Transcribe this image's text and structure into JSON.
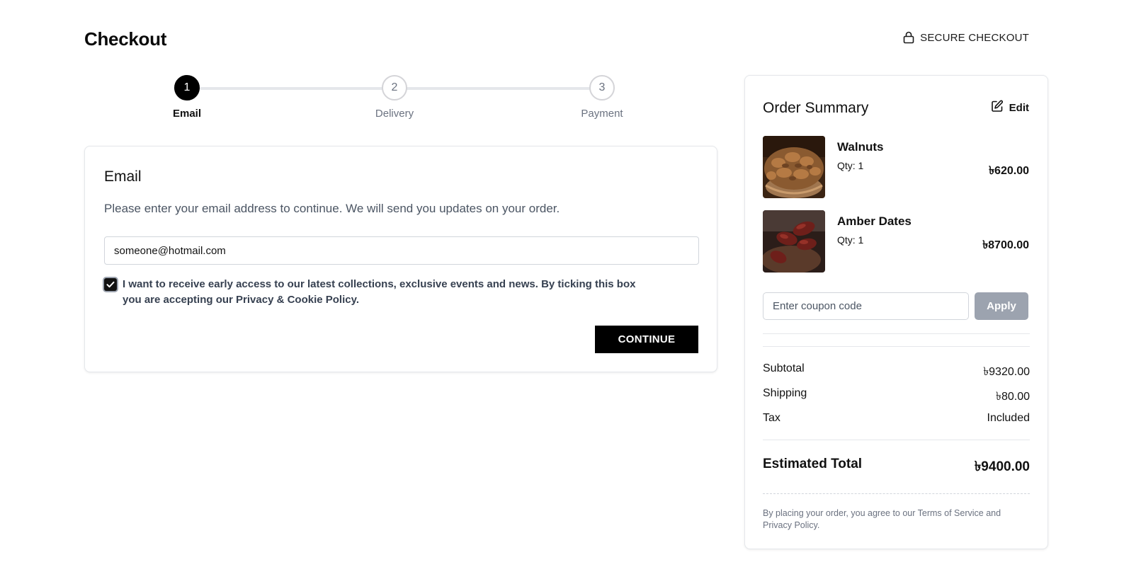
{
  "page": {
    "title": "Checkout",
    "secure_label": "SECURE CHECKOUT"
  },
  "stepper": {
    "steps": [
      {
        "number": "1",
        "label": "Email",
        "active": true
      },
      {
        "number": "2",
        "label": "Delivery",
        "active": false
      },
      {
        "number": "3",
        "label": "Payment",
        "active": false
      }
    ]
  },
  "email_section": {
    "heading": "Email",
    "description": "Please enter your email address to continue. We will send you updates on your order.",
    "email_value": "someone@hotmail.com",
    "opt_in_checked": true,
    "opt_in_text": "I want to receive early access to our latest collections, exclusive events and news. By ticking this box you are accepting our Privacy & Cookie Policy.",
    "continue_label": "CONTINUE"
  },
  "summary": {
    "title": "Order Summary",
    "edit_label": "Edit",
    "items": [
      {
        "name": "Walnuts",
        "qty": "Qty: 1",
        "price": "৳620.00",
        "image": "walnuts-photo"
      },
      {
        "name": "Amber Dates",
        "qty": "Qty: 1",
        "price": "৳8700.00",
        "image": "dates-photo"
      }
    ],
    "coupon_placeholder": "Enter coupon code",
    "apply_label": "Apply",
    "subtotal_label": "Subtotal",
    "subtotal_value": "৳9320.00",
    "shipping_label": "Shipping",
    "shipping_value": "৳80.00",
    "tax_label": "Tax",
    "tax_value": "Included",
    "total_label": "Estimated Total",
    "total_value": "৳9400.00",
    "legal_text": "By placing your order, you agree to our Terms of Service and Privacy Policy."
  },
  "colors": {
    "primary": "#000000",
    "muted": "#6b7280",
    "border": "#e5e7eb",
    "apply_disabled": "#9ca3af"
  },
  "icons": {
    "secure": "lock-icon",
    "edit": "edit-icon",
    "check": "check-icon"
  }
}
